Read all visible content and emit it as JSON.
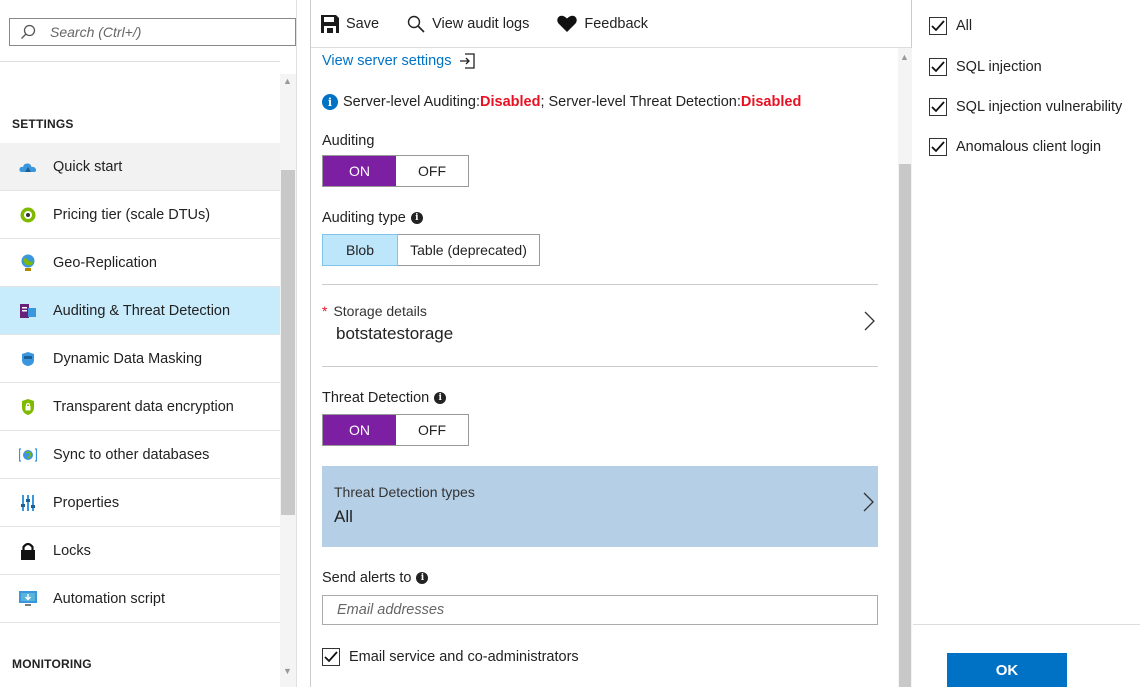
{
  "search": {
    "placeholder": "Search (Ctrl+/)"
  },
  "sidebar": {
    "section_settings": "SETTINGS",
    "section_monitoring": "MONITORING",
    "items": [
      {
        "label": "Quick start",
        "icon": "cloud-icon"
      },
      {
        "label": "Pricing tier (scale DTUs)",
        "icon": "pricing-tier-icon"
      },
      {
        "label": "Geo-Replication",
        "icon": "globe-icon"
      },
      {
        "label": "Auditing & Threat Detection",
        "icon": "auditing-icon",
        "selected": true
      },
      {
        "label": "Dynamic Data Masking",
        "icon": "data-masking-icon"
      },
      {
        "label": "Transparent data encryption",
        "icon": "shield-lock-icon"
      },
      {
        "label": "Sync to other databases",
        "icon": "sync-icon"
      },
      {
        "label": "Properties",
        "icon": "properties-icon"
      },
      {
        "label": "Locks",
        "icon": "lock-icon"
      },
      {
        "label": "Automation script",
        "icon": "automation-script-icon"
      }
    ]
  },
  "toolbar": {
    "save_label": "Save",
    "audit_logs_label": "View audit logs",
    "feedback_label": "Feedback"
  },
  "main": {
    "server_settings_link": "View server settings",
    "info": {
      "prefix": "Server-level Auditing: ",
      "auditing_status": "Disabled",
      "middle": "; Server-level Threat Detection: ",
      "threat_status": "Disabled"
    },
    "auditing": {
      "label": "Auditing",
      "on": "ON",
      "off": "OFF",
      "value": "ON"
    },
    "auditing_type": {
      "label": "Auditing type",
      "blob": "Blob",
      "table": "Table (deprecated)",
      "value": "Blob"
    },
    "storage": {
      "label": "Storage details",
      "value": "botstatestorage"
    },
    "threat_detection": {
      "label": "Threat Detection",
      "on": "ON",
      "off": "OFF",
      "value": "ON"
    },
    "threat_types": {
      "label": "Threat Detection types",
      "value": "All"
    },
    "send_alerts": {
      "label": "Send alerts to",
      "placeholder": "Email addresses"
    },
    "email_admins": {
      "label": "Email service and co-administrators",
      "checked": true
    }
  },
  "right_panel": {
    "options": [
      {
        "label": "All",
        "checked": true
      },
      {
        "label": "SQL injection",
        "checked": true
      },
      {
        "label": "SQL injection vulnerability",
        "checked": true
      },
      {
        "label": "Anomalous client login",
        "checked": true
      }
    ],
    "ok_label": "OK"
  },
  "colors": {
    "accent_blue": "#0072c6",
    "toggle_on": "#7c1fa3",
    "selected_nav": "#c8ecfc",
    "disabled_red": "#e81123",
    "threat_types_bg": "#b5cfe6"
  }
}
